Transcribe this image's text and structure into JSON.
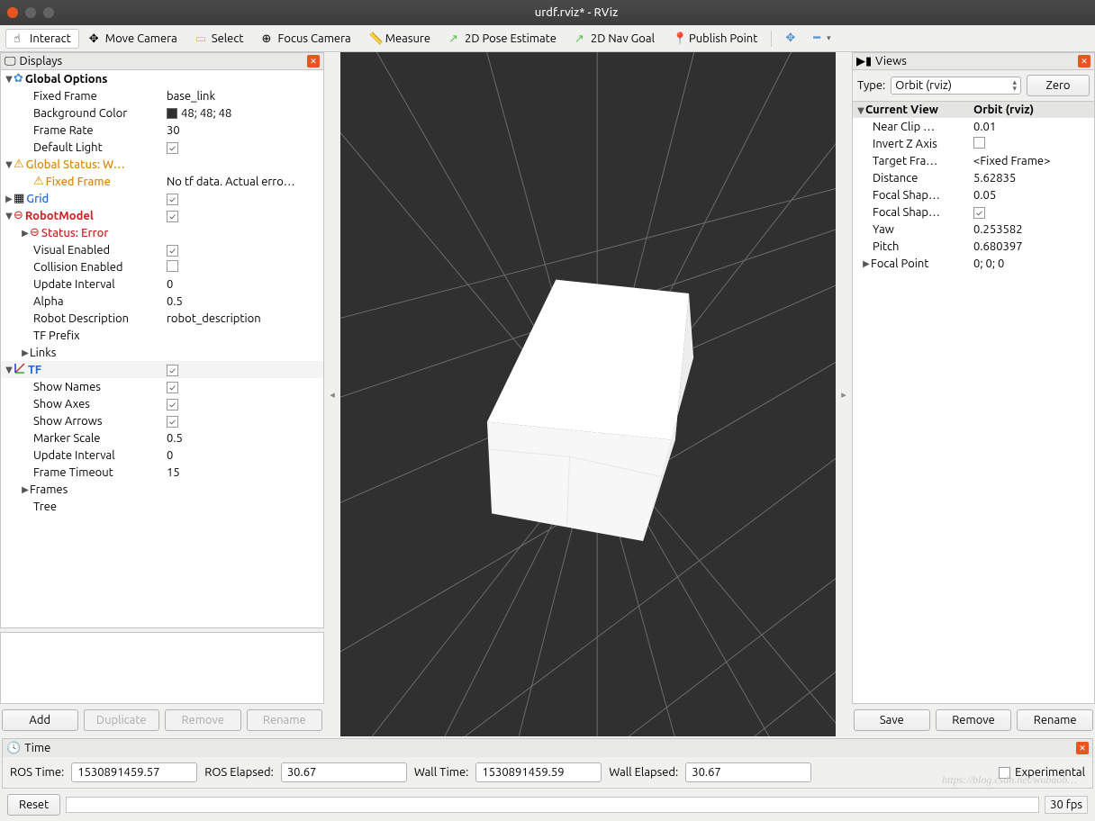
{
  "window": {
    "title": "urdf.rviz* - RViz"
  },
  "toolbar": {
    "interact": "Interact",
    "moveCamera": "Move Camera",
    "select": "Select",
    "focusCamera": "Focus Camera",
    "measure": "Measure",
    "pose2d": "2D Pose Estimate",
    "nav2d": "2D Nav Goal",
    "publishPoint": "Publish Point"
  },
  "displays": {
    "title": "Displays",
    "globalOptions": {
      "label": "Global Options",
      "fixedFrame": {
        "k": "Fixed Frame",
        "v": "base_link"
      },
      "bgColor": {
        "k": "Background Color",
        "v": "48; 48; 48"
      },
      "frameRate": {
        "k": "Frame Rate",
        "v": "30"
      },
      "defaultLight": {
        "k": "Default Light",
        "v": true
      }
    },
    "globalStatus": {
      "label": "Global Status: W…",
      "fixedFrame": {
        "k": "Fixed Frame",
        "v": "No tf data.  Actual erro…"
      }
    },
    "grid": {
      "label": "Grid",
      "v": true
    },
    "robotModel": {
      "label": "RobotModel",
      "v": true,
      "status": "Status: Error",
      "visual": {
        "k": "Visual Enabled",
        "v": true
      },
      "collision": {
        "k": "Collision Enabled",
        "v": false
      },
      "updateInterval": {
        "k": "Update Interval",
        "v": "0"
      },
      "alpha": {
        "k": "Alpha",
        "v": "0.5"
      },
      "robotDesc": {
        "k": "Robot Description",
        "v": "robot_description"
      },
      "tfPrefix": {
        "k": "TF Prefix",
        "v": ""
      },
      "links": "Links"
    },
    "tf": {
      "label": "TF",
      "v": true,
      "showNames": {
        "k": "Show Names",
        "v": true
      },
      "showAxes": {
        "k": "Show Axes",
        "v": true
      },
      "showArrows": {
        "k": "Show Arrows",
        "v": true
      },
      "markerScale": {
        "k": "Marker Scale",
        "v": "0.5"
      },
      "updateInterval": {
        "k": "Update Interval",
        "v": "0"
      },
      "frameTimeout": {
        "k": "Frame Timeout",
        "v": "15"
      },
      "frames": "Frames",
      "tree": "Tree"
    },
    "buttons": {
      "add": "Add",
      "duplicate": "Duplicate",
      "remove": "Remove",
      "rename": "Rename"
    }
  },
  "views": {
    "title": "Views",
    "typeLabel": "Type:",
    "typeValue": "Orbit (rviz)",
    "zero": "Zero",
    "currentView": {
      "k": "Current View",
      "v": "Orbit (rviz)"
    },
    "nearClip": {
      "k": "Near Clip …",
      "v": "0.01"
    },
    "invertZ": {
      "k": "Invert Z Axis",
      "v": false
    },
    "targetFrame": {
      "k": "Target Fra…",
      "v": "<Fixed Frame>"
    },
    "distance": {
      "k": "Distance",
      "v": "5.62835"
    },
    "focalShapeSize": {
      "k": "Focal Shap…",
      "v": "0.05"
    },
    "focalShapeFixed": {
      "k": "Focal Shap…",
      "v": true
    },
    "yaw": {
      "k": "Yaw",
      "v": "0.253582"
    },
    "pitch": {
      "k": "Pitch",
      "v": "0.680397"
    },
    "focalPoint": {
      "k": "Focal Point",
      "v": "0; 0; 0"
    },
    "buttons": {
      "save": "Save",
      "remove": "Remove",
      "rename": "Rename"
    }
  },
  "time": {
    "title": "Time",
    "rosTimeLabel": "ROS Time:",
    "rosTime": "1530891459.57",
    "rosElapsedLabel": "ROS Elapsed:",
    "rosElapsed": "30.67",
    "wallTimeLabel": "Wall Time:",
    "wallTime": "1530891459.59",
    "wallElapsedLabel": "Wall Elapsed:",
    "wallElapsed": "30.67",
    "experimental": "Experimental",
    "reset": "Reset",
    "fps": "30 fps"
  },
  "watermark": "https://blog.csdn.net/wubaob…"
}
